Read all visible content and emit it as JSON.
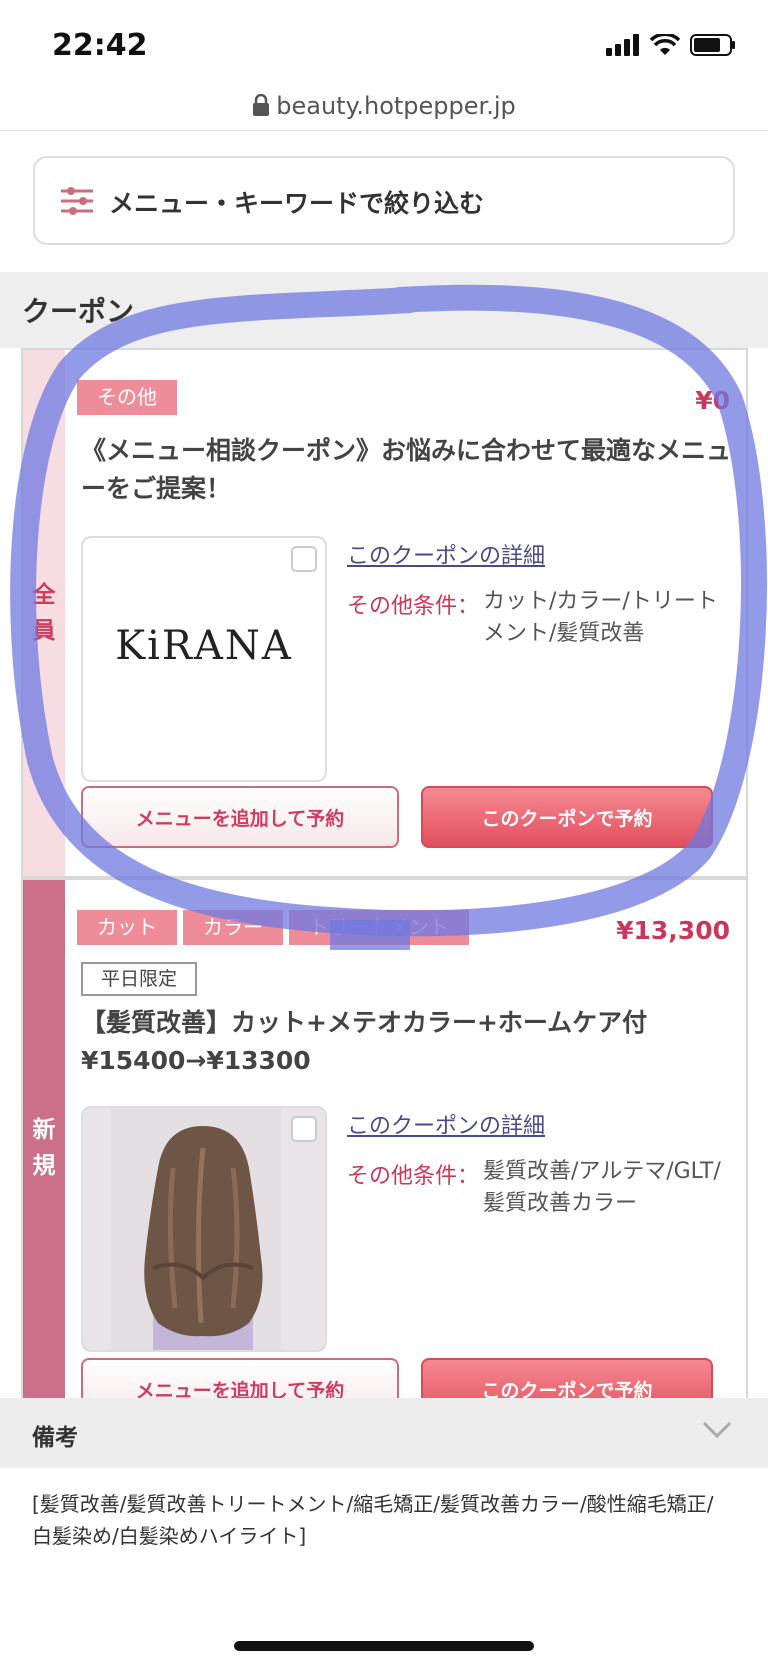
{
  "status_bar": {
    "time": "22:42"
  },
  "browser": {
    "url": "beauty.hotpepper.jp"
  },
  "filter": {
    "label": "メニュー・キーワードで絞り込む"
  },
  "section": {
    "title": "クーポン"
  },
  "coupons": [
    {
      "target": [
        "全",
        "員"
      ],
      "tags": [
        "その他"
      ],
      "price": "¥0",
      "title": "《メニュー相談クーポン》お悩みに合わせて最適なメニューをご提案！",
      "thumb_logo": "KiRANA",
      "detail_link": "このクーポンの詳細",
      "cond_label": "その他条件：",
      "cond_value": "カット/カラー/トリートメント/髪質改善",
      "btn_add": "メニューを追加して予約",
      "btn_reserve": "このクーポンで予約"
    },
    {
      "target": [
        "新",
        "規"
      ],
      "tags": [
        "カット",
        "カラー",
        "トリートメント"
      ],
      "price": "¥13,300",
      "limit": "平日限定",
      "title": "【髪質改善】カット+メテオカラー+ホームケア付 ¥15400→¥13300",
      "detail_link": "このクーポンの詳細",
      "cond_label": "その他条件：",
      "cond_value": "髪質改善/アルテマ/GLT/髪質改善カラー",
      "btn_add": "メニューを追加して予約",
      "btn_reserve": "このクーポンで予約"
    }
  ],
  "remarks": {
    "title": "備考",
    "text": "[髪質改善/髪質改善トリートメント/縮毛矯正/髪質改善カラー/酸性縮毛矯正/白髪染め/白髪染めハイライト]"
  },
  "colors": {
    "accent": "#c8385a",
    "tag": "#ee8c9a",
    "button": "#e24f5d",
    "annotation": "#6f78e0"
  }
}
